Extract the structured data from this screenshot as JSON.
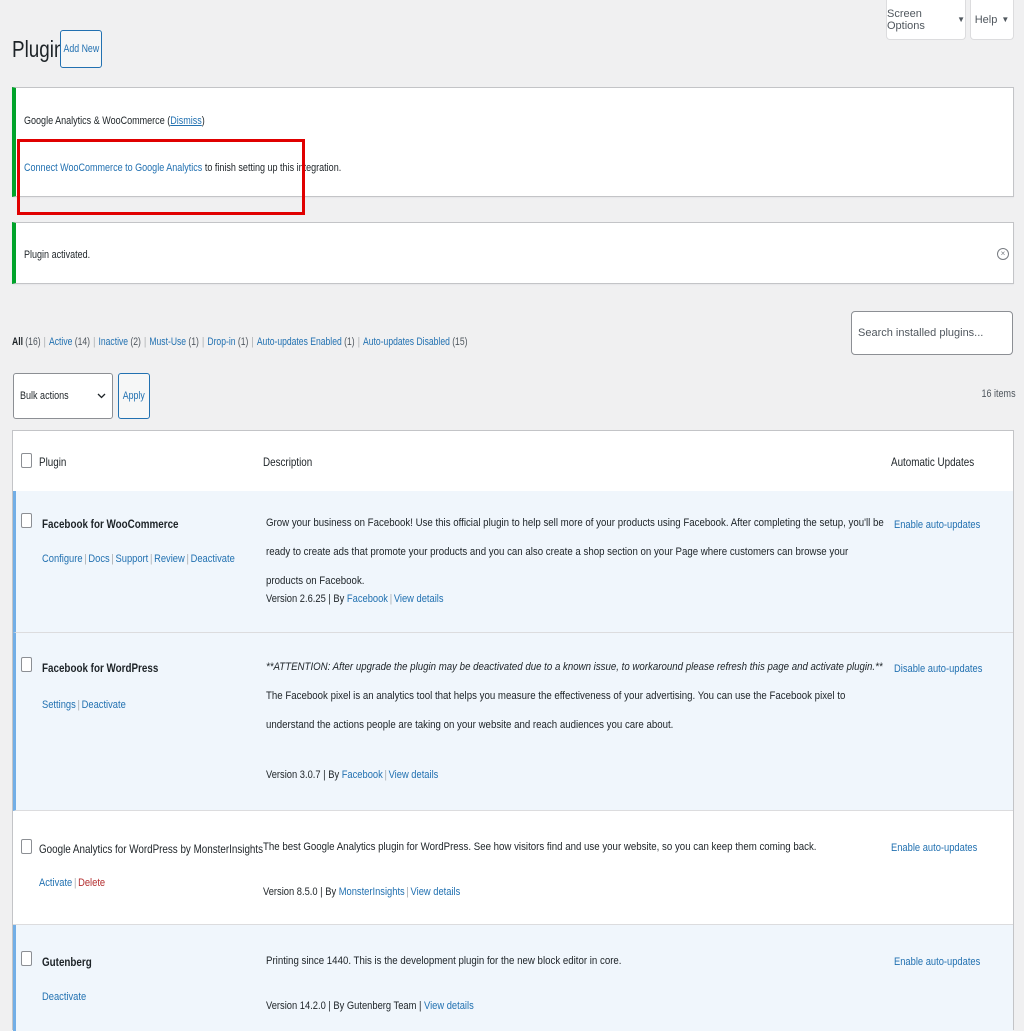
{
  "top_tabs": {
    "screen_options": "Screen Options",
    "help": "Help",
    "caret": "▼"
  },
  "header": {
    "title": "Plugins",
    "add_new": "Add New"
  },
  "notices": {
    "ga_title": "Google Analytics & WooCommerce",
    "ga_dismiss_open": "(",
    "ga_dismiss": "Dismiss",
    "ga_dismiss_close": ")",
    "ga_connect_link": "Connect WooCommerce to Google Analytics",
    "ga_connect_rest": " to finish setting up this integration.",
    "activated": "Plugin activated."
  },
  "filters": [
    {
      "label": "All",
      "count": "(16)",
      "current": true
    },
    {
      "label": "Active",
      "count": "(14)"
    },
    {
      "label": "Inactive",
      "count": "(2)"
    },
    {
      "label": "Must-Use",
      "count": "(1)"
    },
    {
      "label": "Drop-in",
      "count": "(1)"
    },
    {
      "label": "Auto-updates Enabled",
      "count": "(1)"
    },
    {
      "label": "Auto-updates Disabled",
      "count": "(15)"
    }
  ],
  "search": {
    "placeholder": "Search installed plugins..."
  },
  "bulk": {
    "label": "Bulk actions",
    "apply": "Apply",
    "items": "16 items"
  },
  "table": {
    "headers": {
      "plugin": "Plugin",
      "description": "Description",
      "auto": "Automatic Updates"
    },
    "rows": [
      {
        "name": "Facebook for WooCommerce",
        "actions": [
          "Configure",
          "Docs",
          "Support",
          "Review",
          "Deactivate"
        ],
        "description": "Grow your business on Facebook! Use this official plugin to help sell more of your products using Facebook. After completing the setup, you'll be ready to create ads that promote your products and you can also create a shop section on your Page where customers can browse your products on Facebook.",
        "version": "Version 2.6.25 | By ",
        "author": "Facebook",
        "details": "View details",
        "auto": "Enable auto-updates"
      },
      {
        "name": "Facebook for WordPress",
        "actions": [
          "Settings",
          "Deactivate"
        ],
        "description_em": "**ATTENTION: After upgrade the plugin may be deactivated due to a known issue, to workaround please refresh this page and activate plugin.**",
        "description": " The Facebook pixel is an analytics tool that helps you measure the effectiveness of your advertising. You can use the Facebook pixel to understand the actions people are taking on your website and reach audiences you care about.",
        "version": "Version 3.0.7 | By ",
        "author": "Facebook",
        "details": "View details",
        "auto": "Disable auto-updates"
      },
      {
        "name": "Google Analytics for WordPress by MonsterInsights",
        "actions": [
          "Activate",
          "Delete"
        ],
        "description": "The best Google Analytics plugin for WordPress. See how visitors find and use your website, so you can keep them coming back.",
        "version": "Version 8.5.0 | By ",
        "author": "MonsterInsights",
        "details": "View details",
        "auto": "Enable auto-updates"
      },
      {
        "name": "Gutenberg",
        "actions": [
          "Deactivate"
        ],
        "description": "Printing since 1440. This is the development plugin for the new block editor in core.",
        "version": "Version 14.2.0 | By Gutenberg Team | ",
        "author": "",
        "details": "View details",
        "auto": "Enable auto-updates"
      }
    ]
  },
  "colors": {
    "link": "#2271b1",
    "notice_success": "#00a32a",
    "highlight": "#e00000",
    "active_row_bg": "#f0f6fc",
    "active_row_border": "#72aee6",
    "delete": "#b32d2e"
  }
}
